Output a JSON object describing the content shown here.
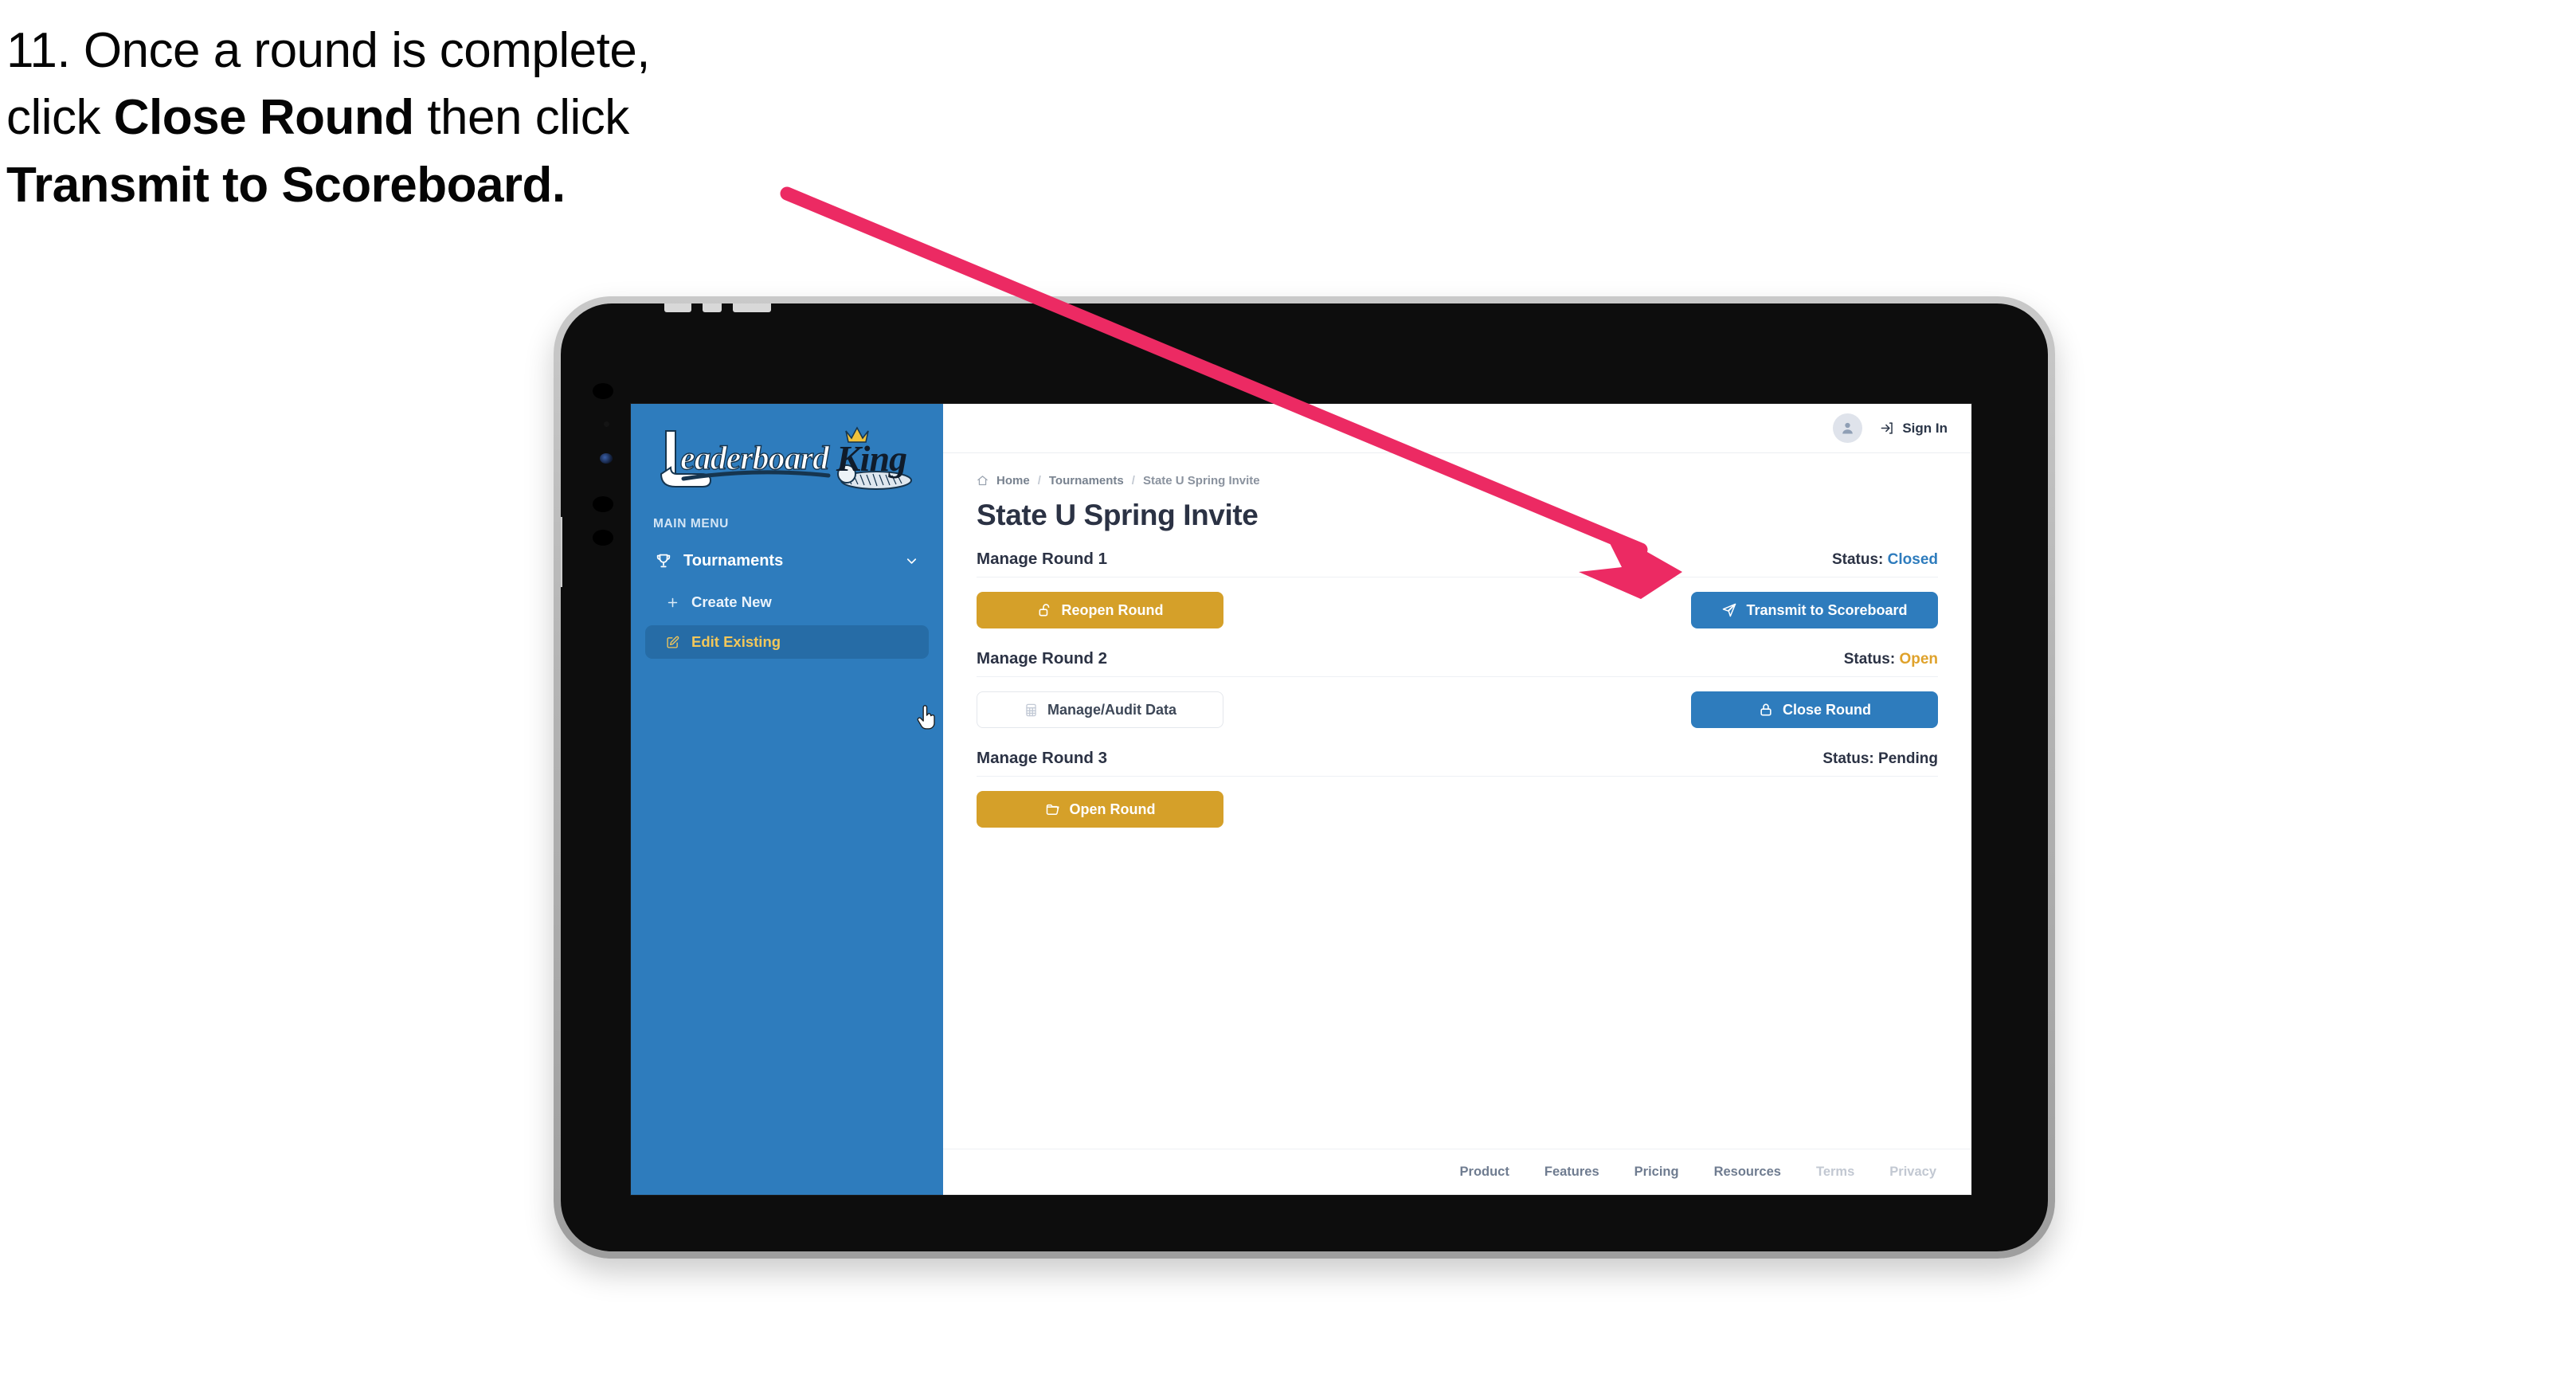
{
  "caption": {
    "line1_a": "11. Once a round is complete,",
    "line2_a": "click ",
    "line2_b": "Close Round",
    "line2_c": " then click",
    "line3_b": "Transmit to Scoreboard."
  },
  "annotation": {
    "arrow_color": "#ec2a63",
    "name": "pointer-arrow-to-transmit-button"
  },
  "sidebar": {
    "brand": {
      "word1": "Leaderboard",
      "word2": "King",
      "bg_color": "#2e7cbd"
    },
    "section_label": "MAIN MENU",
    "nav": [
      {
        "label": "Tournaments",
        "icon": "trophy-icon",
        "expanded": true,
        "chevron": "chevron-down-icon"
      }
    ],
    "sub_items": [
      {
        "label": "Create New",
        "icon": "plus-icon",
        "active": false
      },
      {
        "label": "Edit Existing",
        "icon": "edit-square-icon",
        "active": true
      }
    ],
    "cursor": "pointer-hand-cursor"
  },
  "topbar": {
    "avatar_icon": "user-avatar-icon",
    "signin_icon": "sign-in-arrow-icon",
    "signin_label": "Sign In"
  },
  "breadcrumb": {
    "home_icon": "home-icon",
    "items": [
      "Home",
      "Tournaments",
      "State U Spring Invite"
    ],
    "separator": "/"
  },
  "page": {
    "title": "State U Spring Invite"
  },
  "rounds": [
    {
      "name": "Manage Round 1",
      "status_label": "Status:",
      "status_value": "Closed",
      "status_kind": "closed",
      "status_color": "#2e7cbd",
      "left_button": {
        "label": "Reopen Round",
        "icon": "unlock-icon",
        "style": "gold"
      },
      "right_button": {
        "label": "Transmit to Scoreboard",
        "icon": "paper-plane-icon",
        "style": "blue"
      }
    },
    {
      "name": "Manage Round 2",
      "status_label": "Status:",
      "status_value": "Open",
      "status_kind": "open",
      "status_color": "#dfa22b",
      "left_button": {
        "label": "Manage/Audit Data",
        "icon": "table-grid-icon",
        "style": "ghost"
      },
      "right_button": {
        "label": "Close Round",
        "icon": "lock-icon",
        "style": "blue"
      }
    },
    {
      "name": "Manage Round 3",
      "status_label": "Status:",
      "status_value": "Pending",
      "status_kind": "pending",
      "status_color": "#2b3244",
      "left_button": {
        "label": "Open Round",
        "icon": "folder-open-icon",
        "style": "gold"
      },
      "right_button": null
    }
  ],
  "footer": {
    "links": [
      {
        "label": "Product",
        "muted": false
      },
      {
        "label": "Features",
        "muted": false
      },
      {
        "label": "Pricing",
        "muted": false
      },
      {
        "label": "Resources",
        "muted": false
      },
      {
        "label": "Terms",
        "muted": true
      },
      {
        "label": "Privacy",
        "muted": true
      }
    ]
  },
  "colors": {
    "brand_blue": "#2e7cbd",
    "gold": "#d5a029",
    "status_open": "#dfa22b",
    "arrow_pink": "#ec2a63",
    "sidebar_active": "#266ca6",
    "active_text_gold": "#f2c75a"
  }
}
